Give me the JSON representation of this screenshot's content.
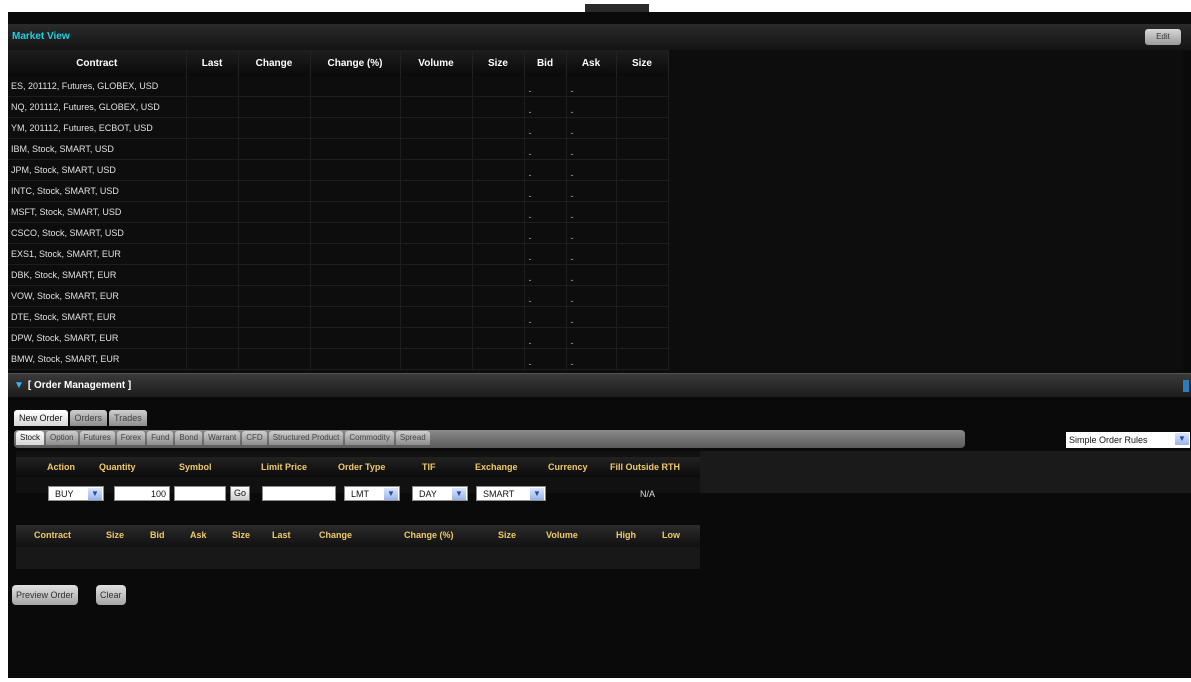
{
  "market_view": {
    "title": "Market View",
    "edit_label": "Edit",
    "columns": [
      "Contract",
      "Last",
      "Change",
      "Change (%)",
      "Volume",
      "Size",
      "Bid",
      "Ask",
      "Size"
    ],
    "rows": [
      "ES, 201112, Futures, GLOBEX, USD",
      "NQ, 201112, Futures, GLOBEX, USD",
      "YM, 201112, Futures, ECBOT, USD",
      "IBM, Stock, SMART, USD",
      "JPM, Stock, SMART, USD",
      "INTC, Stock, SMART, USD",
      "MSFT, Stock, SMART, USD",
      "CSCO, Stock, SMART, USD",
      "EXS1, Stock, SMART, EUR",
      "DBK, Stock, SMART, EUR",
      "VOW, Stock, SMART, EUR",
      "DTE, Stock, SMART, EUR",
      "DPW, Stock, SMART, EUR",
      "BMW, Stock, SMART, EUR"
    ],
    "empty_marker": "-"
  },
  "order_management": {
    "title": "[ Order Management ]",
    "tabs": [
      "New Order",
      "Orders",
      "Trades"
    ],
    "subtabs": [
      "Stock",
      "Option",
      "Futures",
      "Forex",
      "Fund",
      "Bond",
      "Warrant",
      "CFD",
      "Structured Product",
      "Commodity",
      "Spread"
    ],
    "rules_select": "Simple Order Rules",
    "form": {
      "headers": [
        "Action",
        "Quantity",
        "Symbol",
        "Limit Price",
        "Order Type",
        "TIF",
        "Exchange",
        "Currency",
        "Fill Outside RTH"
      ],
      "action": "BUY",
      "quantity": "100",
      "symbol": "",
      "go_label": "Go",
      "limit_price": "",
      "order_type": "LMT",
      "tif": "DAY",
      "exchange": "SMART",
      "fill_outside_rth": "N/A"
    },
    "quote_headers": [
      "Contract",
      "Size",
      "Bid",
      "Ask",
      "Size",
      "Last",
      "Change",
      "Change (%)",
      "Size",
      "Volume",
      "High",
      "Low"
    ],
    "buttons": {
      "preview": "Preview Order",
      "clear": "Clear"
    }
  },
  "colors": {
    "market_view_title": "#1fd0e0",
    "header_gold": "#f0c96a",
    "background": "#0a0a0a"
  }
}
